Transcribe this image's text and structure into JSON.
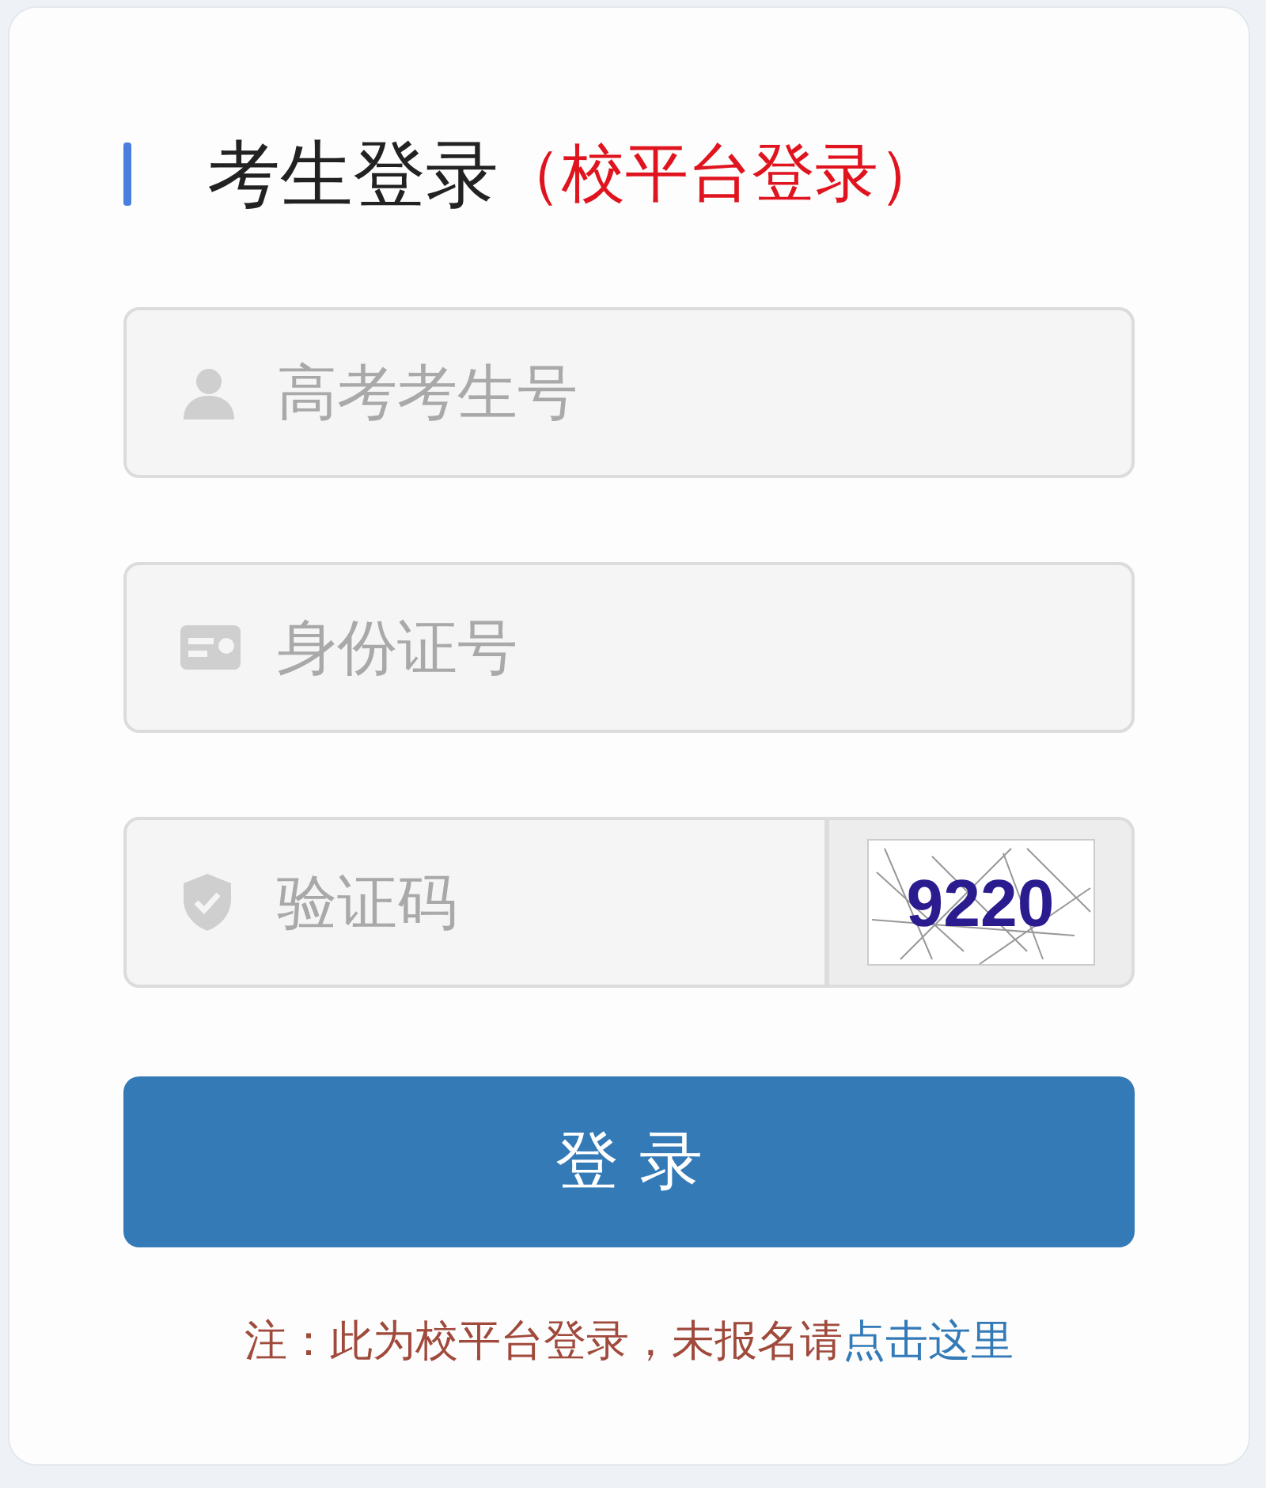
{
  "title": {
    "main": "考生登录",
    "sub": "（校平台登录）"
  },
  "fields": [
    {
      "kind": "text",
      "placeholder": "高考考生号"
    },
    {
      "kind": "text",
      "placeholder": "身份证号"
    },
    {
      "kind": "captcha",
      "placeholder": "验证码",
      "captcha_text": "9220"
    }
  ],
  "submit": "登 录",
  "note": {
    "text": "注：此为校平台登录，未报名请",
    "link": "点击这里"
  }
}
